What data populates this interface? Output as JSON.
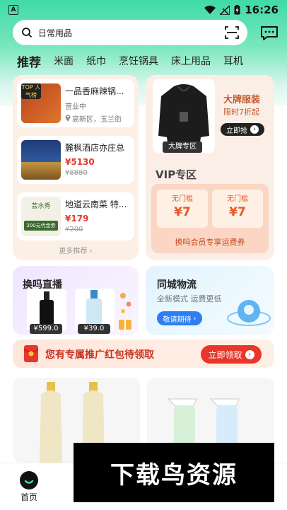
{
  "status_bar": {
    "time": "16:26",
    "app_icon_letter": "A"
  },
  "search": {
    "value": "日常用品"
  },
  "tabs": [
    "推荐",
    "米面",
    "纸巾",
    "烹饪锅具",
    "床上用品",
    "耳机"
  ],
  "shops": [
    {
      "name": "一品香麻辣锅...",
      "status": "营业中",
      "location": "高新区，玉兰街",
      "badge": "TOP 人气榜"
    },
    {
      "name": "麓枫酒店亦庄总",
      "price": "¥5130",
      "old_price": "¥8880"
    },
    {
      "name": "地道云南菜 特...",
      "price": "¥179",
      "old_price": "¥200",
      "thumb_text": "200元代金券",
      "thumb_brand": "芸水秀"
    }
  ],
  "more_label": "更多推荐",
  "brand": {
    "tag": "大牌专区",
    "title": "大牌服装",
    "subtitle": "限时7折起",
    "button": "立即抢"
  },
  "vip": {
    "title": "VIP专区",
    "coupons": [
      {
        "label": "无门槛",
        "value": "¥7"
      },
      {
        "label": "无门槛",
        "value": "¥7"
      }
    ],
    "desc": "换吗会员专享运费券"
  },
  "live": {
    "title": "换吗直播",
    "products": [
      {
        "price": "¥599.0"
      },
      {
        "price": "¥39.0"
      }
    ]
  },
  "city": {
    "title": "同城物流",
    "subtitle": "全新模式  运费更低",
    "button": "敬请期待"
  },
  "promo": {
    "text": "您有专属推广红包待领取",
    "button": "立即领取"
  },
  "bottom_nav": {
    "home": "首页"
  },
  "watermark": "下载鸟资源",
  "colors": {
    "accent": "#3fd9a8",
    "price_red": "#e8382b",
    "promo_red": "#e8362b",
    "city_blue": "#2f7df1"
  }
}
